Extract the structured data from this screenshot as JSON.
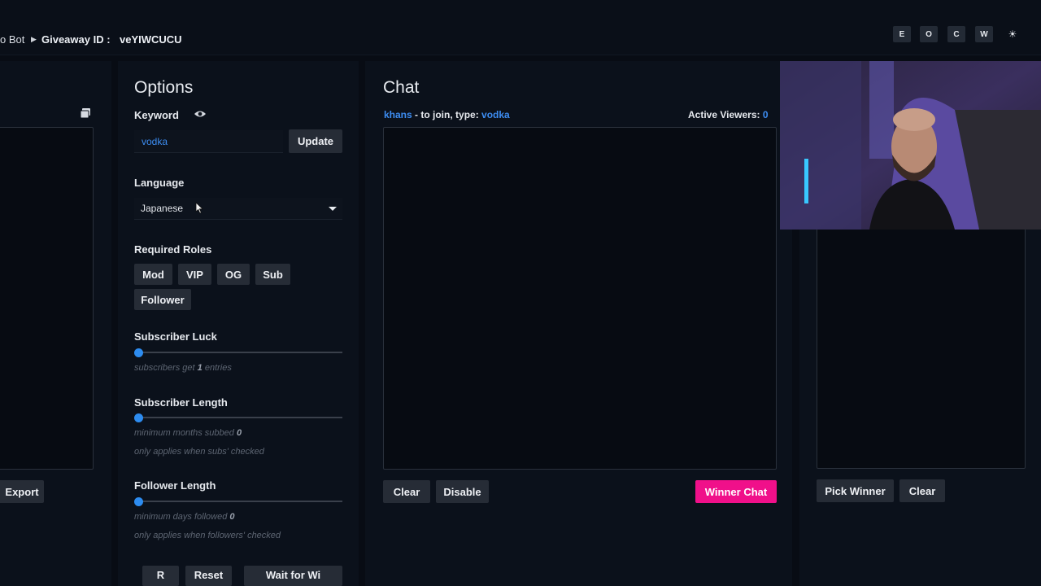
{
  "topbar": {
    "crumb_app": "o Bot",
    "crumb_giveaway_label": "Giveaway ID :",
    "crumb_giveaway_id": "veYIWCUCU",
    "buttons": [
      "E",
      "O",
      "C",
      "W",
      "☀"
    ]
  },
  "left": {
    "export_label": "Export"
  },
  "options": {
    "title": "Options",
    "keyword_label": "Keyword",
    "keyword_value": "vodka",
    "update_label": "Update",
    "language_label": "Language",
    "language_value": "Japanese",
    "required_roles_label": "Required Roles",
    "roles": [
      "Mod",
      "VIP",
      "OG",
      "Sub",
      "Follower"
    ],
    "sub_luck_label": "Subscriber Luck",
    "sub_luck_hint_pre": "subscribers get",
    "sub_luck_value": "1",
    "sub_luck_hint_post": "entries",
    "sub_length_label": "Subscriber Length",
    "sub_length_hint": "minimum months subbed",
    "sub_length_value": "0",
    "sub_length_note": "only applies when subs' checked",
    "follower_length_label": "Follower Length",
    "follower_length_hint": "minimum days followed",
    "follower_length_value": "0",
    "follower_length_note": "only applies when followers' checked",
    "bottom_buttons": [
      "R",
      "Reset",
      "Wait for Wi"
    ]
  },
  "chat": {
    "title": "Chat",
    "streamer": "khans",
    "join_text": "- to join, type:",
    "join_keyword": "vodka",
    "active_viewers_label": "Active Viewers:",
    "active_viewers_value": "0",
    "clear_label": "Clear",
    "disable_label": "Disable",
    "winner_chat_label": "Winner Chat"
  },
  "winner": {
    "pick_label": "Pick Winner",
    "clear_label": "Clear"
  },
  "colors": {
    "accent": "#3d8df2",
    "pink": "#f0108a",
    "background": "#080c14"
  }
}
